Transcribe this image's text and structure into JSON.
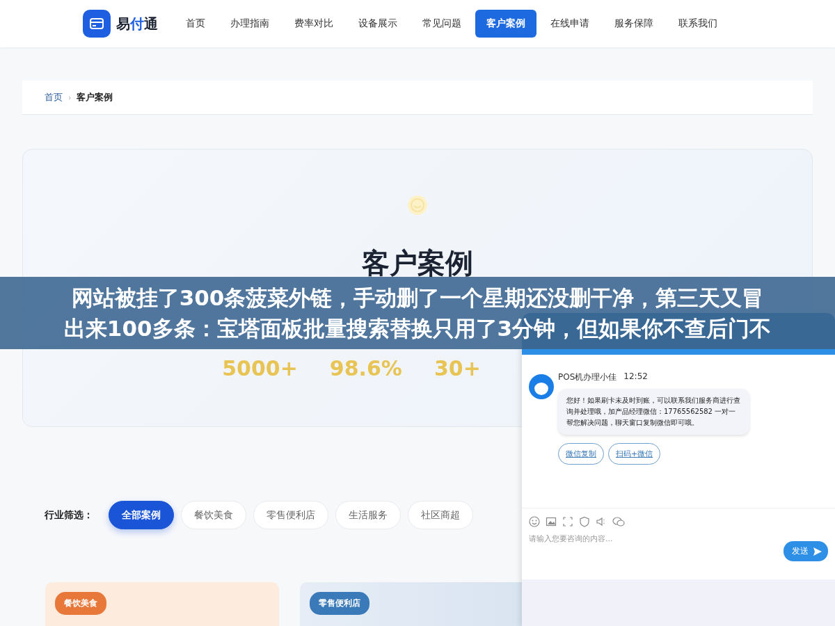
{
  "nav": {
    "logo": [
      {
        "text": "易",
        "accent": false
      },
      {
        "text": "付",
        "accent": true
      },
      {
        "text": "通",
        "accent": false
      }
    ],
    "items": [
      {
        "label": "首页",
        "selected": false
      },
      {
        "label": "办理指南",
        "selected": false
      },
      {
        "label": "费率对比",
        "selected": false
      },
      {
        "label": "设备展示",
        "selected": false
      },
      {
        "label": "常见问题",
        "selected": false
      },
      {
        "label": "客户案例",
        "selected": true
      },
      {
        "label": "在线申请",
        "selected": false
      },
      {
        "label": "服务保障",
        "selected": false
      },
      {
        "label": "联系我们",
        "selected": false
      }
    ]
  },
  "breadcrumb": {
    "home": "首页",
    "separator": "›",
    "current": "客户案例"
  },
  "hero": {
    "title": "客户案例",
    "stats": [
      "5000+",
      "98.6%",
      "30+"
    ]
  },
  "filter": {
    "label": "行业筛选：",
    "options": [
      {
        "label": "全部案例",
        "selected": true
      },
      {
        "label": "餐饮美食",
        "selected": false
      },
      {
        "label": "零售便利店",
        "selected": false
      },
      {
        "label": "生活服务",
        "selected": false
      },
      {
        "label": "社区商超",
        "selected": false
      }
    ]
  },
  "cards": [
    {
      "tag": "餐饮美食",
      "color": "#e8773a"
    },
    {
      "tag": "零售便利店",
      "color": "#3a7ab8"
    }
  ],
  "banner": [
    "网站被挂了300条菠菜外链，手动删了一个星期还没删干净，第三天又冒",
    "出来100多条：宝塔面板批量搜索替换只用了3分钟，但如果你不查后门不"
  ],
  "chat": {
    "sender": "POS机办理小佳",
    "time": "12:52",
    "message": "您好！如果刷卡未及时到账，可以联系我们服务商进行查询并处理哦，加产品经理微信：17765562582 一对一帮您解决问题，聊天窗口复制微信即可哦。",
    "actions": [
      "微信复制",
      "扫码+微信"
    ],
    "placeholder": "请输入您要咨询的内容...",
    "send": "发送"
  }
}
